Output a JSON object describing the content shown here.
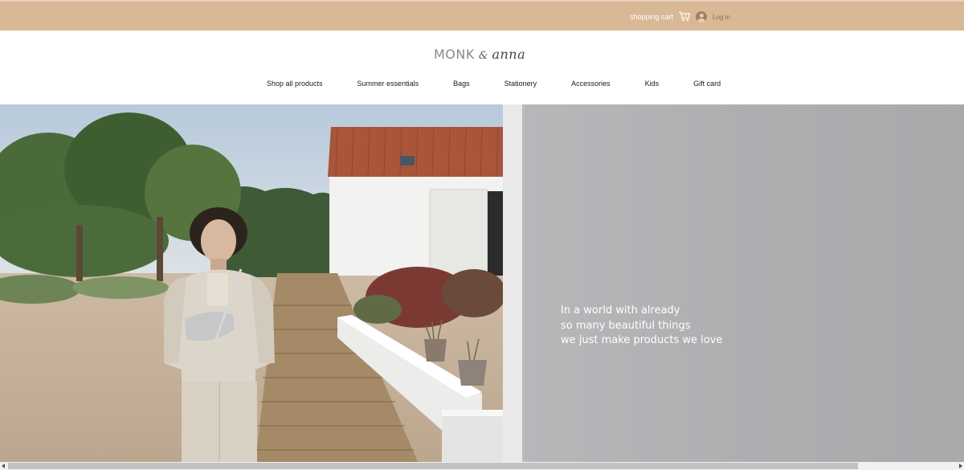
{
  "topbar": {
    "cart_label": "shopping cart",
    "cart_icon": "shopping-cart-icon",
    "login_label": "Log in",
    "login_icon": "avatar-icon",
    "background": "#d9b896"
  },
  "logo": {
    "part1": "MONK",
    "part2": "&",
    "part3": "anna"
  },
  "nav": {
    "items": [
      {
        "label": "Shop all products"
      },
      {
        "label": "Summer essentials"
      },
      {
        "label": "Bags"
      },
      {
        "label": "Stationery"
      },
      {
        "label": "Accessories"
      },
      {
        "label": "Kids"
      },
      {
        "label": "Gift card"
      }
    ]
  },
  "hero": {
    "lines": [
      "In a world with already",
      "so many beautiful things",
      "we just make products we love"
    ]
  }
}
